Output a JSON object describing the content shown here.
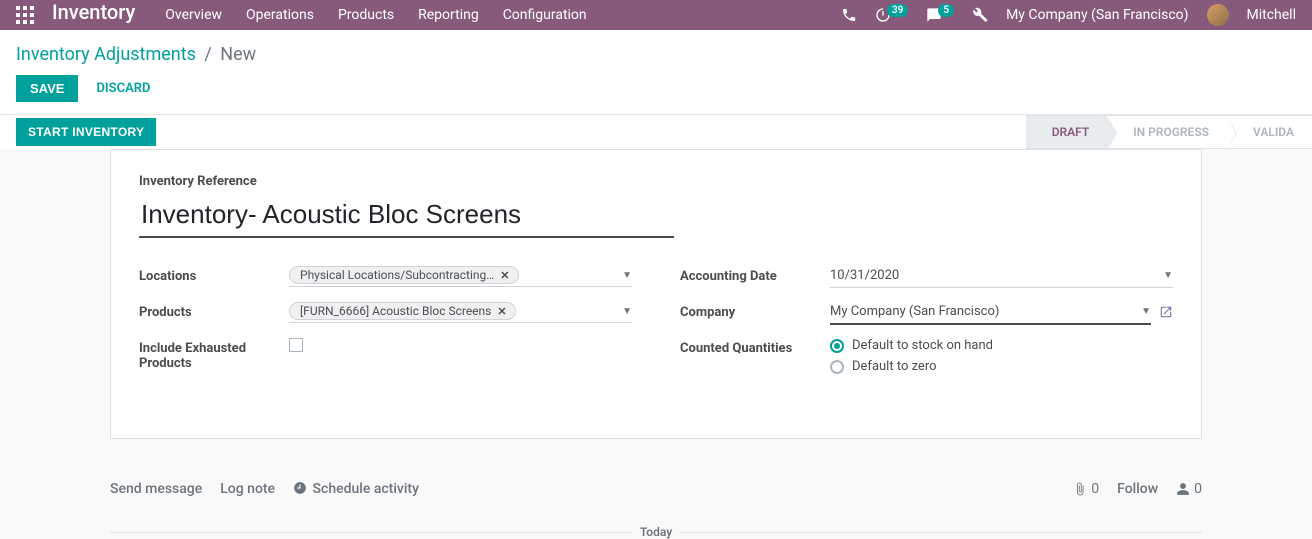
{
  "nav": {
    "brand": "Inventory",
    "items": [
      "Overview",
      "Operations",
      "Products",
      "Reporting",
      "Configuration"
    ],
    "timer_badge": "39",
    "msg_badge": "5",
    "company": "My Company (San Francisco)",
    "user": "Mitchell"
  },
  "breadcrumb": {
    "parent": "Inventory Adjustments",
    "current": "New"
  },
  "buttons": {
    "save": "SAVE",
    "discard": "DISCARD",
    "start": "START INVENTORY"
  },
  "status": {
    "steps": [
      "DRAFT",
      "IN PROGRESS",
      "VALIDA"
    ],
    "active": 0
  },
  "form": {
    "ref_label": "Inventory Reference",
    "ref_value": "Inventory- Acoustic Bloc Screens",
    "labels": {
      "locations": "Locations",
      "products": "Products",
      "include_exhausted": "Include Exhausted Products",
      "accounting_date": "Accounting Date",
      "company": "Company",
      "counted_qty": "Counted Quantities"
    },
    "locations_tag": "Physical Locations/Subcontracting…",
    "products_tag": "[FURN_6666] Acoustic Bloc Screens",
    "include_exhausted_checked": false,
    "accounting_date": "10/31/2020",
    "company": "My Company (San Francisco)",
    "counted_opts": {
      "stock": "Default to stock on hand",
      "zero": "Default to zero"
    },
    "counted_selected": "stock"
  },
  "chatter": {
    "send": "Send message",
    "log": "Log note",
    "schedule": "Schedule activity",
    "attach_count": "0",
    "follow": "Follow",
    "followers": "0",
    "today": "Today"
  }
}
